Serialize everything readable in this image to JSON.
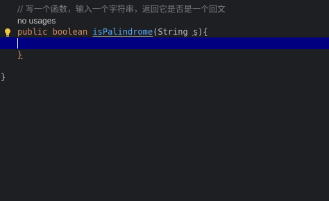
{
  "editor": {
    "comment": "// 写一个函数，输入一个字符串，返回它是否是一个回文",
    "usages_hint": "no usages",
    "signature": {
      "modifier": "public",
      "return_type": "boolean",
      "method_name": "isPalindrome",
      "open_paren": "(",
      "param_type": "String",
      "param_name": "s",
      "close_tail": "){"
    },
    "method_close_brace": "}",
    "class_close_brace": "}"
  },
  "icons": {
    "intention": "lightbulb-icon"
  },
  "colors": {
    "background": "#1e1f22",
    "current_line": "#000080",
    "keyword": "#cf8e6d",
    "method": "#56a8f5",
    "comment": "#7a7e85",
    "bulb": "#f2c744"
  }
}
